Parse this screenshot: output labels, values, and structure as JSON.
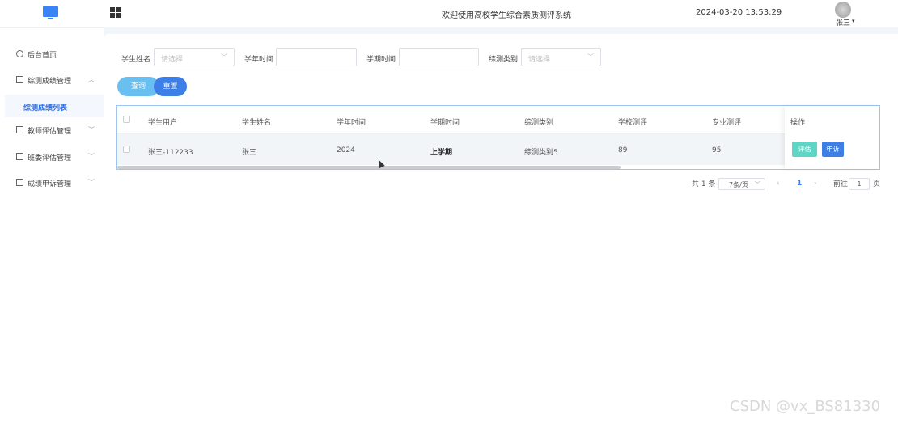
{
  "header": {
    "system_title": "欢迎使用高校学生综合素质测评系统",
    "datetime": "2024-03-20 13:53:29",
    "user_name": "张三"
  },
  "sidebar": {
    "items": [
      {
        "label": "后台首页",
        "icon": "clock-icon"
      },
      {
        "label": "综测成绩管理",
        "icon": "list-icon",
        "expanded": true
      },
      {
        "label": "教师评估管理",
        "icon": "list-icon"
      },
      {
        "label": "班委评估管理",
        "icon": "list-icon"
      },
      {
        "label": "成绩申诉管理",
        "icon": "list-icon"
      }
    ],
    "active_subitem": "综测成绩列表"
  },
  "filters": {
    "student_name_label": "学生姓名",
    "student_name_placeholder": "请选择",
    "year_label": "学年时间",
    "term_label": "学期时间",
    "category_label": "综测类别",
    "category_placeholder": "请选择"
  },
  "buttons": {
    "query": "查询",
    "reset": "重置"
  },
  "table": {
    "headers": [
      "学生用户",
      "学生姓名",
      "学年时间",
      "学期时间",
      "综测类别",
      "学校测评",
      "专业测评"
    ],
    "op_header": "操作",
    "rows": [
      {
        "cells": [
          "张三-112233",
          "张三",
          "2024",
          "上学期",
          "综测类别5",
          "89",
          "95"
        ],
        "actions": [
          "评估",
          "申诉"
        ]
      }
    ]
  },
  "pagination": {
    "total_text": "共 1 条",
    "page_size": "7条/页",
    "current_page": "1",
    "goto_prefix": "前往",
    "goto_value": "1",
    "goto_suffix": "页"
  },
  "watermark": "CSDN @vx_BS81330",
  "colors": {
    "primary": "#3d7fe6",
    "query_button": "#69bff0",
    "review_button": "#5ed6c6"
  }
}
